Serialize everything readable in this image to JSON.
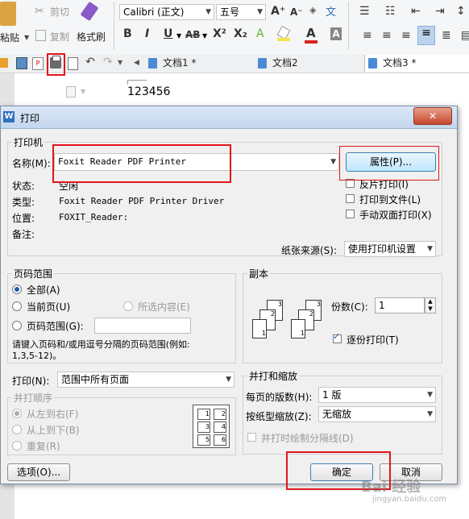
{
  "ribbon": {
    "cut_label": "剪切",
    "copy_label": "复制",
    "paste_label": "粘贴",
    "format_painter_label": "格式刷",
    "font_name": "Calibri (正文)",
    "font_size": "五号",
    "grow_font": "A⁺",
    "shrink_font": "A⁻",
    "phonetic_label": "文",
    "bold": "B",
    "italic": "I",
    "underline": "U",
    "strike": "AB",
    "superscript": "X²",
    "subscript": "X₂"
  },
  "tabs": [
    {
      "label": "文档1 *"
    },
    {
      "label": "文档2"
    },
    {
      "label": "文档3 *"
    }
  ],
  "document": {
    "text": "123456"
  },
  "dialog": {
    "title": "打印",
    "close_glyph": "✕",
    "printer_group": "打印机",
    "name_label": "名称(M):",
    "printer_name": "Foxit Reader PDF Printer",
    "properties_button": "属性(P)...",
    "status_label": "状态:",
    "status_value": "空闲",
    "type_label": "类型:",
    "type_value": "Foxit Reader PDF Printer Driver",
    "location_label": "位置:",
    "location_value": "FOXIT_Reader:",
    "comment_label": "备注:",
    "reverse_print": "反片打印(I)",
    "print_to_file": "打印到文件(L)",
    "manual_duplex": "手动双面打印(X)",
    "paper_source_label": "纸张来源(S):",
    "paper_source_value": "使用打印机设置",
    "range_group": "页码范围",
    "range_all": "全部(A)",
    "range_current": "当前页(U)",
    "range_selection": "所选内容(E)",
    "range_pages": "页码范围(G):",
    "range_hint_1": "请键入页码和/或用逗号分隔的页码范围(例如:",
    "range_hint_2": "1,3,5-12)。",
    "copies_group": "副本",
    "copies_label": "份数(C):",
    "copies_value": "1",
    "collate_label": "逐份打印(T)",
    "print_label": "打印(N):",
    "print_value": "范围中所有页面",
    "order_group": "并打顺序",
    "order_lr": "从左到右(F)",
    "order_tb": "从上到下(B)",
    "order_repeat": "重复(R)",
    "scale_group": "并打和缩放",
    "pages_per_sheet_label": "每页的版数(H):",
    "pages_per_sheet_value": "1 版",
    "scale_label": "按纸型缩放(Z):",
    "scale_value": "无缩放",
    "draw_borders": "并打时绘制分隔线(D)",
    "options_button": "选项(O)...",
    "ok_button": "确定",
    "cancel_button": "取消",
    "grid_nums": [
      "1",
      "2",
      "3",
      "4",
      "5",
      "6"
    ]
  },
  "watermark": {
    "text": "Bai 经验",
    "sub": "jingyan.baidu.com"
  },
  "colors": {
    "highlight_red": "#e0161b",
    "accent_blue": "#2f6fc0",
    "font_color_red": "#d22",
    "highlight_yellow": "#f4e44a"
  }
}
